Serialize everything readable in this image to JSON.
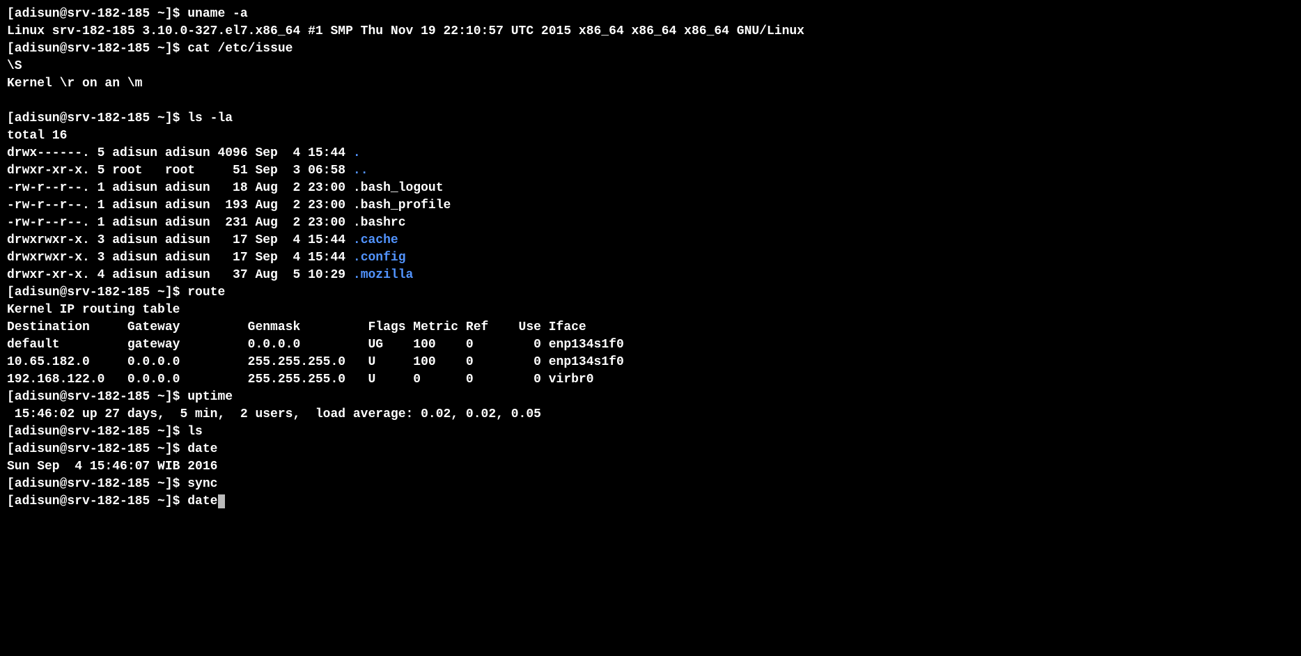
{
  "prompt": "[adisun@srv-182-185 ~]$ ",
  "commands": {
    "uname": "uname -a",
    "cat_issue": "cat /etc/issue",
    "ls_la": "ls -la",
    "route": "route",
    "uptime": "uptime",
    "ls": "ls",
    "date1": "date",
    "sync": "sync",
    "date2": "date"
  },
  "outputs": {
    "uname_out": "Linux srv-182-185 3.10.0-327.el7.x86_64 #1 SMP Thu Nov 19 22:10:57 UTC 2015 x86_64 x86_64 x86_64 GNU/Linux",
    "issue_1": "\\S",
    "issue_2": "Kernel \\r on an \\m",
    "ls_total": "total 16",
    "ls_row_1_pre": "drwx------. 5 adisun adisun 4096 Sep  4 15:44 ",
    "ls_row_1_name": ".",
    "ls_row_2_pre": "drwxr-xr-x. 5 root   root     51 Sep  3 06:58 ",
    "ls_row_2_name": "..",
    "ls_row_3": "-rw-r--r--. 1 adisun adisun   18 Aug  2 23:00 .bash_logout",
    "ls_row_4": "-rw-r--r--. 1 adisun adisun  193 Aug  2 23:00 .bash_profile",
    "ls_row_5": "-rw-r--r--. 1 adisun adisun  231 Aug  2 23:00 .bashrc",
    "ls_row_6_pre": "drwxrwxr-x. 3 adisun adisun   17 Sep  4 15:44 ",
    "ls_row_6_name": ".cache",
    "ls_row_7_pre": "drwxrwxr-x. 3 adisun adisun   17 Sep  4 15:44 ",
    "ls_row_7_name": ".config",
    "ls_row_8_pre": "drwxr-xr-x. 4 adisun adisun   37 Aug  5 10:29 ",
    "ls_row_8_name": ".mozilla",
    "route_title": "Kernel IP routing table",
    "route_header": "Destination     Gateway         Genmask         Flags Metric Ref    Use Iface",
    "route_r1": "default         gateway         0.0.0.0         UG    100    0        0 enp134s1f0",
    "route_r2": "10.65.182.0     0.0.0.0         255.255.255.0   U     100    0        0 enp134s1f0",
    "route_r3": "192.168.122.0   0.0.0.0         255.255.255.0   U     0      0        0 virbr0",
    "uptime_out": " 15:46:02 up 27 days,  5 min,  2 users,  load average: 0.02, 0.02, 0.05",
    "date_out": "Sun Sep  4 15:46:07 WIB 2016"
  }
}
